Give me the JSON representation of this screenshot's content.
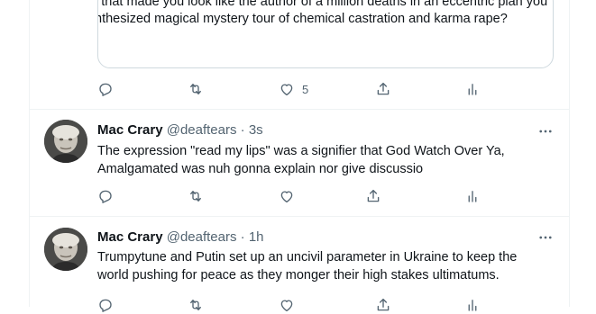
{
  "quoted_tweet": {
    "lines": [
      "l that made you look like the author of a million deaths in an eccentric plan you",
      "nthesized magical mystery tour of chemical castration and karma rape?"
    ]
  },
  "tweets": [
    {
      "author": "Mac Crary",
      "handle": "@deaftears",
      "separator": "·",
      "time": "3s",
      "lines": [
        "The expression \"read my lips\" was a signifier that God Watch Over Ya,",
        "Amalgamated was nuh gonna explain nor give discussio"
      ],
      "like_count": ""
    },
    {
      "author": "Mac Crary",
      "handle": "@deaftears",
      "separator": "·",
      "time": "1h",
      "lines": [
        "Trumpytune and Putin set up an uncivil parameter in Ukraine to keep the",
        "world pushing for peace as they monger their high stakes ultimatums."
      ],
      "like_count": ""
    }
  ],
  "top_actions": {
    "like_count": "5"
  },
  "colors": {
    "text": "#0f1419",
    "secondary": "#536471",
    "border": "#eff3f4",
    "quote_border": "#cfd9de"
  },
  "icons": [
    "reply-icon",
    "retweet-icon",
    "like-icon",
    "share-icon",
    "analytics-icon",
    "more-icon"
  ]
}
